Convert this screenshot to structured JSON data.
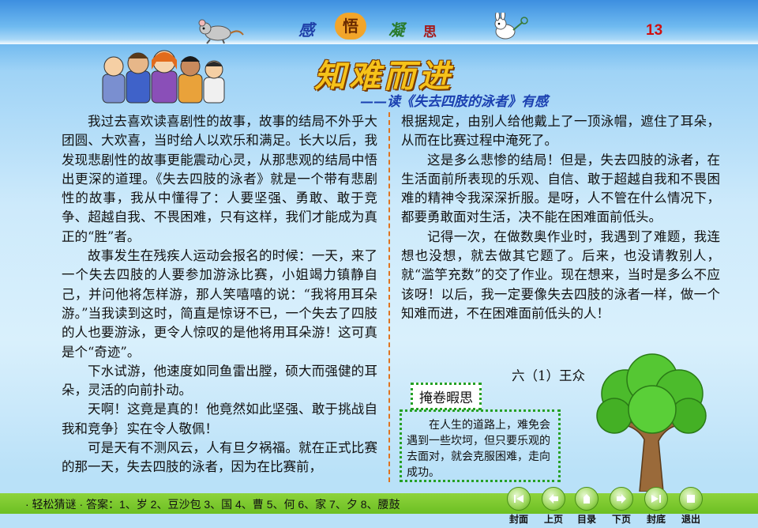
{
  "header": {
    "words": [
      "感",
      "悟",
      "凝",
      "思"
    ],
    "page_number": "13"
  },
  "article": {
    "title": "知难而进",
    "subtitle": "——读《失去四肢的泳者》有感",
    "left_paragraphs": [
      "我过去喜欢读喜剧性的故事，故事的结局不外乎大团圆、大欢喜，当时给人以欢乐和满足。长大以后，我发现悲剧性的故事更能震动心灵，从那悲观的结局中悟出更深的道理。《失去四肢的泳者》就是一个带有悲剧性的故事，我从中懂得了：人要坚强、勇敢、敢于竞争、超越自我、不畏困难，只有这样，我们才能成为真正的“胜”者。",
      "故事发生在残疾人运动会报名的时候：一天，来了一个失去四肢的人要参加游泳比赛，小姐竭力镇静自己，并问他将怎样游，那人笑嘻嘻的说：“我将用耳朵游。”当我读到这时，简直是惊讶不已，一个失去了四肢的人也要游泳，更令人惊叹的是他将用耳朵游！这可真是个“奇迹”。",
      "下水试游，他速度如同鱼雷出膛，硕大而强健的耳朵，灵活的向前扑动。",
      "天啊！这竟是真的！他竟然如此坚强、敢于挑战自我和竞争｝实在令人敬佩！",
      "可是天有不测风云，人有旦夕祸福。就在正式比赛的那一天，失去四肢的泳者，因为在比赛前，"
    ],
    "right_paragraphs": [
      "根据规定，由别人给他戴上了一顶泳帽，遮住了耳朵，从而在比赛过程中淹死了。",
      "这是多么悲惨的结局！但是，失去四肢的泳者，在生活面前所表现的乐观、自信、敢于超越自我和不畏困难的精神令我深深折服。是呀，人不管在什么情况下，都要勇敢面对生活，决不能在困难面前低头。",
      "记得一次，在做数奥作业时，我遇到了难题，我连想也没想，就去做其它题了。后来，也没请教别人，就“滥竽充数”的交了作业。现在想来，当时是多么不应该呀！以后，我一定要像失去四肢的泳者一样，做一个知难而进，不在困难面前低头的人！"
    ],
    "author": "六（1）王众"
  },
  "reflection": {
    "title": "掩卷暇思",
    "text": "在人生的道路上，难免会遇到一些坎坷，但只要乐观的去面对，就会克服困难，走向 成功。"
  },
  "riddle_bar": {
    "text": "· 轻松猜谜 · 答案：1、岁 2、豆沙包 3、国 4、曹 5、何 6、家 7、夕 8、腰鼓"
  },
  "nav": [
    {
      "label": "封面",
      "icon": "first-page-icon"
    },
    {
      "label": "上页",
      "icon": "prev-page-icon"
    },
    {
      "label": "目录",
      "icon": "contents-icon"
    },
    {
      "label": "下页",
      "icon": "next-page-icon"
    },
    {
      "label": "封底",
      "icon": "last-page-icon"
    },
    {
      "label": "退出",
      "icon": "exit-icon"
    }
  ],
  "colors": {
    "title_fill": "#f6c21a",
    "subtitle": "#1a3fb0",
    "divider": "#e0731f",
    "reflection_border": "#25a025",
    "bottom_bar": "#7cc82e",
    "page_number": "#d01010"
  }
}
